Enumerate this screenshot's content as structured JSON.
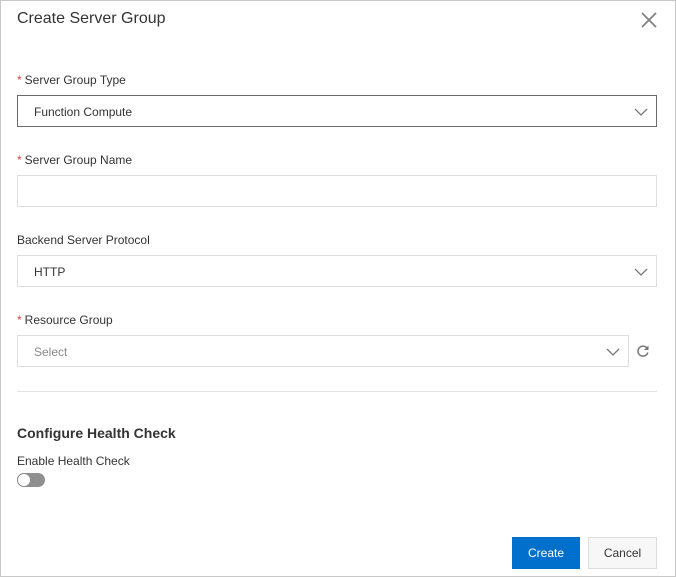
{
  "dialog": {
    "title": "Create Server Group",
    "close_icon": "close-icon"
  },
  "form": {
    "server_group_type": {
      "label": "Server Group Type",
      "required": "*",
      "value": "Function Compute"
    },
    "server_group_name": {
      "label": "Server Group Name",
      "required": "*",
      "value": ""
    },
    "backend_protocol": {
      "label": "Backend Server Protocol",
      "value": "HTTP"
    },
    "resource_group": {
      "label": "Resource Group",
      "required": "*",
      "placeholder": "Select",
      "refresh_icon": "refresh-icon"
    }
  },
  "health_check": {
    "section_title": "Configure Health Check",
    "enable_label": "Enable Health Check",
    "enabled": false
  },
  "footer": {
    "create_label": "Create",
    "cancel_label": "Cancel"
  },
  "colors": {
    "primary": "#0070cc",
    "required": "#e3423a"
  }
}
